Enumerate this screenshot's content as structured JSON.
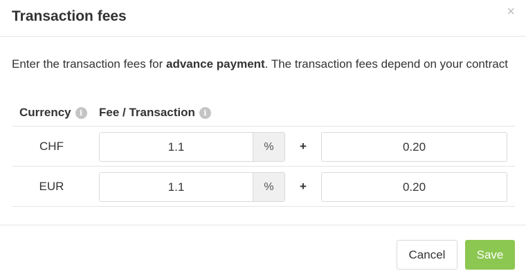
{
  "dialog": {
    "title": "Transaction fees",
    "close_glyph": "×"
  },
  "intro": {
    "before": "Enter the transaction fees for ",
    "bold": "advance payment",
    "after": ". The transaction fees depend on your contract"
  },
  "table": {
    "headers": {
      "currency": "Currency",
      "fee": "Fee / Transaction"
    },
    "info_icon_glyph": "i",
    "rows": [
      {
        "currency": "CHF",
        "percent_value": "1.1",
        "percent_unit": "%",
        "plus": "+",
        "fixed_value": "0.20"
      },
      {
        "currency": "EUR",
        "percent_value": "1.1",
        "percent_unit": "%",
        "plus": "+",
        "fixed_value": "0.20"
      }
    ]
  },
  "footer": {
    "cancel_label": "Cancel",
    "save_label": "Save"
  },
  "colors": {
    "save_button": "#8cc751",
    "border": "#d9d9d9",
    "addon_background": "#f0f0f0",
    "info_icon": "#c4c4c4"
  },
  "icons": {
    "close": "close-icon",
    "info": "info-icon"
  }
}
